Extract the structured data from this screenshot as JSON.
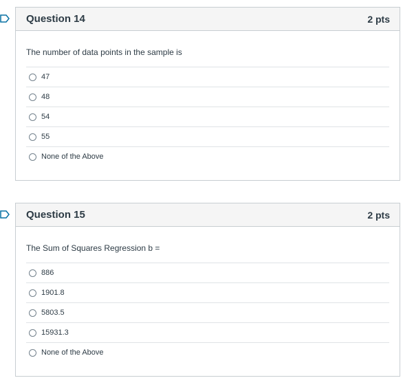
{
  "questions": [
    {
      "title": "Question 14",
      "points": "2 pts",
      "text": "The number of data points in the sample is",
      "answers": [
        "47",
        "48",
        "54",
        "55",
        "None of the Above"
      ]
    },
    {
      "title": "Question 15",
      "points": "2 pts",
      "text": "The Sum of Squares Regression b =",
      "answers": [
        "886",
        "1901.8",
        "5803.5",
        "15931.3",
        "None of the Above"
      ]
    }
  ],
  "colors": {
    "flag": "#0770a3",
    "border": "#c7cdd1",
    "header_bg": "#f5f5f5",
    "text": "#2d3b45"
  }
}
